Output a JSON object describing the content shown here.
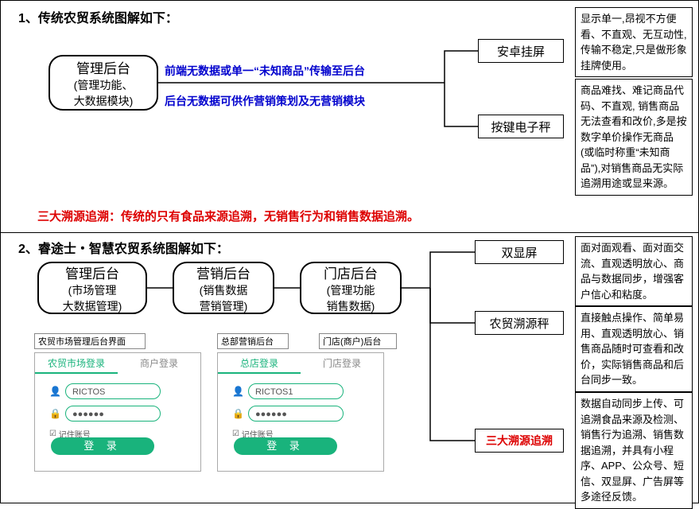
{
  "s1": {
    "title": "1、传统农贸系统图解如下：",
    "mgmt": {
      "t": "管理后台",
      "s1": "(管理功能、",
      "s2": "大数据模块)"
    },
    "note1": "前端无数据或单一“未知商品”传输至后台",
    "note2": "后台无数据可供作营销策划及无营销模块",
    "r1": "安卓挂屏",
    "r2": "按键电子秤",
    "t1": "显示单一,昂视不方便看、不直观、无互动性,传输不稳定,只是做形象挂牌使用。",
    "t2": "商品难找、难记商品代码、不直观, 销售商品无法查看和改价,多是按数字单价操作无商品(或临时称重“未知商品”),对销售商品无实际追溯用途或显来源。",
    "red": "三大溯源追溯：传统的只有食品来源追溯，无销售行为和销售数据追溯。"
  },
  "s2": {
    "title": "2、睿途士・智慧农贸系统图解如下：",
    "b1": {
      "t": "管理后台",
      "s1": "(市场管理",
      "s2": "大数据管理)"
    },
    "b2": {
      "t": "营销后台",
      "s1": "(销售数据",
      "s2": "营销管理)"
    },
    "b3": {
      "t": "门店后台",
      "s1": "(管理功能",
      "s2": "销售数据)"
    },
    "r1": "双显屏",
    "r2": "农贸溯源秤",
    "r3": "三大溯源追溯",
    "t1": "面对面观看、面对面交流、直观透明放心、商品与数据同步，增强客户信心和粘度。",
    "t2": "直接触点操作、简单易用、直观透明放心、销售商品随时可查看和改价，实际销售商品和后台同步一致。",
    "t3": "数据自动同步上传、可追溯食品来源及检测、销售行为追溯、销售数据追溯，并具有小程序、APP、公众号、短信、双显屏、广告屏等多途径反馈。",
    "l1": "农贸市场管理后台界面",
    "l2": "总部营销后台",
    "l3": "门店(商户)后台",
    "login1": {
      "tab1": "农贸市场登录",
      "tab2": "商户登录",
      "user": "RICTOS",
      "pass": "●●●●●●",
      "remember": "记住账号",
      "btn": "登 录"
    },
    "login2": {
      "tab1": "总店登录",
      "tab2": "门店登录",
      "user": "RICTOS1",
      "pass": "●●●●●●",
      "remember": "记住账号",
      "btn": "登 录"
    }
  }
}
